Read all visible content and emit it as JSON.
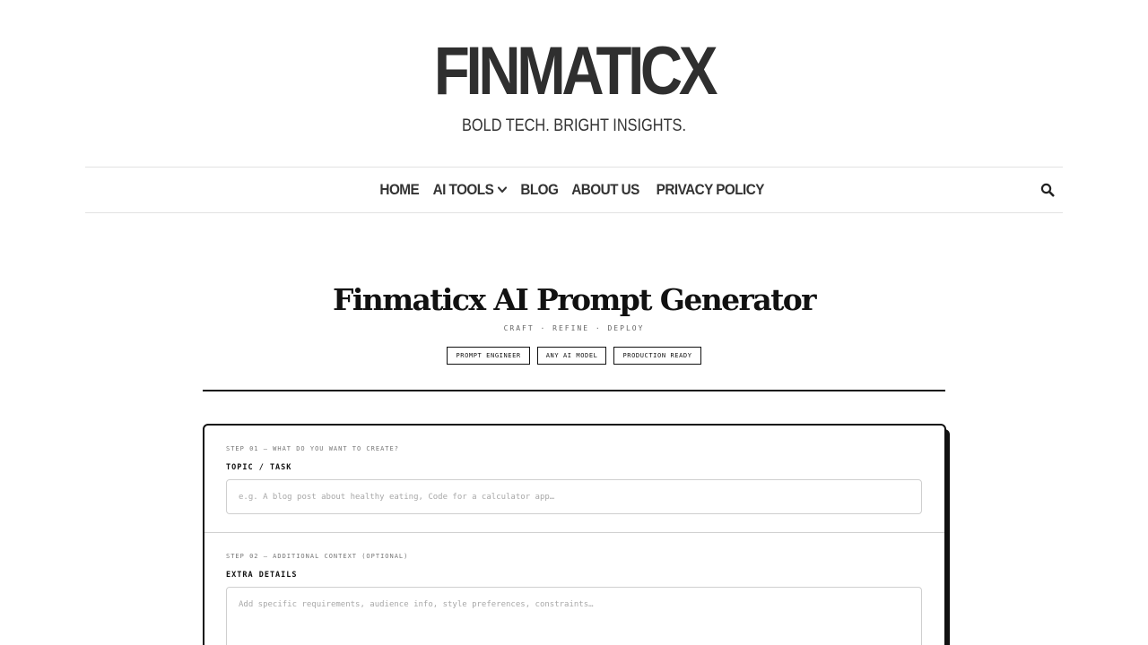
{
  "site": {
    "title": "FINMATICX",
    "tagline": "BOLD TECH. BRIGHT INSIGHTS."
  },
  "nav": {
    "items": [
      {
        "label": "HOME"
      },
      {
        "label": "AI TOOLS",
        "has_dropdown": true
      },
      {
        "label": "BLOG"
      },
      {
        "label": "ABOUT US"
      },
      {
        "label": "PRIVACY POLICY"
      }
    ],
    "search_icon": "search-icon"
  },
  "hero": {
    "title": "Finmaticx AI Prompt Generator",
    "subtitle": "CRAFT · REFINE · DEPLOY",
    "badges": [
      "PROMPT ENGINEER",
      "ANY AI MODEL",
      "PRODUCTION READY"
    ]
  },
  "form": {
    "step1": {
      "kicker": "STEP 01 — WHAT DO YOU WANT TO CREATE?",
      "label": "TOPIC / TASK",
      "value": "",
      "placeholder": "e.g. A blog post about healthy eating, Code for a calculator app…"
    },
    "step2": {
      "kicker": "STEP 02 — ADDITIONAL CONTEXT (OPTIONAL)",
      "label": "EXTRA DETAILS",
      "value": "",
      "placeholder": "Add specific requirements, audience info, style preferences, constraints…"
    }
  },
  "colors": {
    "text": "#333333",
    "ink": "#111111",
    "rule": "#e2e2e2",
    "field_border": "#cfcfcf"
  }
}
